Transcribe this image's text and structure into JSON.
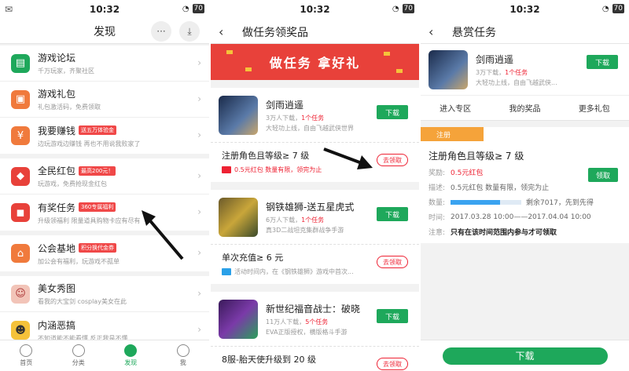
{
  "status": {
    "time": "10:32",
    "battery": "70"
  },
  "discover": {
    "title": "发现",
    "items": [
      {
        "title": "游戏论坛",
        "sub": "千万玩家，齐聚社区",
        "badge": "",
        "color": "#1ea85b",
        "icon": "forum-icon"
      },
      {
        "title": "游戏礼包",
        "sub": "礼包激活码，免费领取",
        "badge": "",
        "color": "#f07a3c",
        "icon": "gift-icon"
      },
      {
        "title": "我要赚钱",
        "sub": "边玩游戏边赚钱 再也不用说我败家了",
        "badge": "送五万体验金",
        "color": "#f07a3c",
        "icon": "money-icon"
      },
      {
        "title": "全民红包",
        "sub": "玩游戏，免费抢现金红包",
        "badge": "最高200元！",
        "color": "#e8413a",
        "icon": "red-envelope-icon"
      },
      {
        "title": "有奖任务",
        "sub": "升级领福利 限量道具购物卡应有尽有",
        "badge": "360专属福利",
        "color": "#e8413a",
        "icon": "task-reward-icon"
      },
      {
        "title": "公会基地",
        "sub": "加公会有福利，玩游戏不孤单",
        "badge": "积分换代金券",
        "color": "#f07a3c",
        "icon": "guild-icon"
      },
      {
        "title": "美女秀图",
        "sub": "看我的大宝剑 cosplay美女在此",
        "badge": "",
        "color": "#f2c4b8",
        "icon": "beauty-icon"
      },
      {
        "title": "内涵恶搞",
        "sub": "不知道能不能看懂 反正我是不懂",
        "badge": "",
        "color": "#f5c23a",
        "icon": "funny-icon"
      }
    ],
    "tabs": [
      "首页",
      "分类",
      "发现",
      "我"
    ]
  },
  "tasks_page": {
    "title": "做任务领奖品",
    "banner": "做任务 拿好礼",
    "games": [
      {
        "name": "剑雨逍遥",
        "downloads": "3万人下载，",
        "tasks": "1个任务",
        "desc": "大轻功上线，自由飞越武侠世界",
        "btn": "下载",
        "task": "注册角色且等级≥ 7 级",
        "task_sub": "0.5元红包 数量有限，领完为止",
        "claim": "去领取"
      },
      {
        "name": "钢铁雄狮-送五星虎式",
        "downloads": "6万人下载，",
        "tasks": "1个任务",
        "desc": "真3D二战坦克集群战争手游",
        "btn": "下载",
        "task": "单次充值≥ 6 元",
        "task_sub": "活动时间内，在《钢铁雄狮》游戏中首次...",
        "claim": "去领取"
      },
      {
        "name": "新世纪福音战士：破晓",
        "downloads": "11万人下载，",
        "tasks": "5个任务",
        "desc": "EVA正版授权，横版格斗手游",
        "btn": "下载",
        "task": "8服-胎天使升级到 20 级",
        "task_sub": "",
        "claim": "去领取"
      }
    ]
  },
  "reward_page": {
    "title": "悬赏任务",
    "game": {
      "name": "剑雨逍遥",
      "downloads": "3万下载，",
      "tasks": "1个任务",
      "desc": "大轻功上线，自由飞越武侠...",
      "btn": "下载"
    },
    "sub_tabs": [
      "进入专区",
      "我的奖品",
      "更多礼包"
    ],
    "ribbon": "注册",
    "task_title": "注册角色且等级≥ 7 级",
    "claim": "领取",
    "reward_label": "奖励:",
    "reward_value": "0.5元红包",
    "desc_label": "描述:",
    "desc_value": "0.5元红包 数量有限，领完为止",
    "qty_label": "数量:",
    "qty_value": "剩余7017，先到先得",
    "qty_fill": 0.7,
    "time_label": "时间:",
    "time_value": "2017.03.28 10:00——2017.04.04 10:00",
    "note_label": "注意:",
    "note_value": "只有在该时间范围内参与才可领取",
    "download": "下载"
  }
}
